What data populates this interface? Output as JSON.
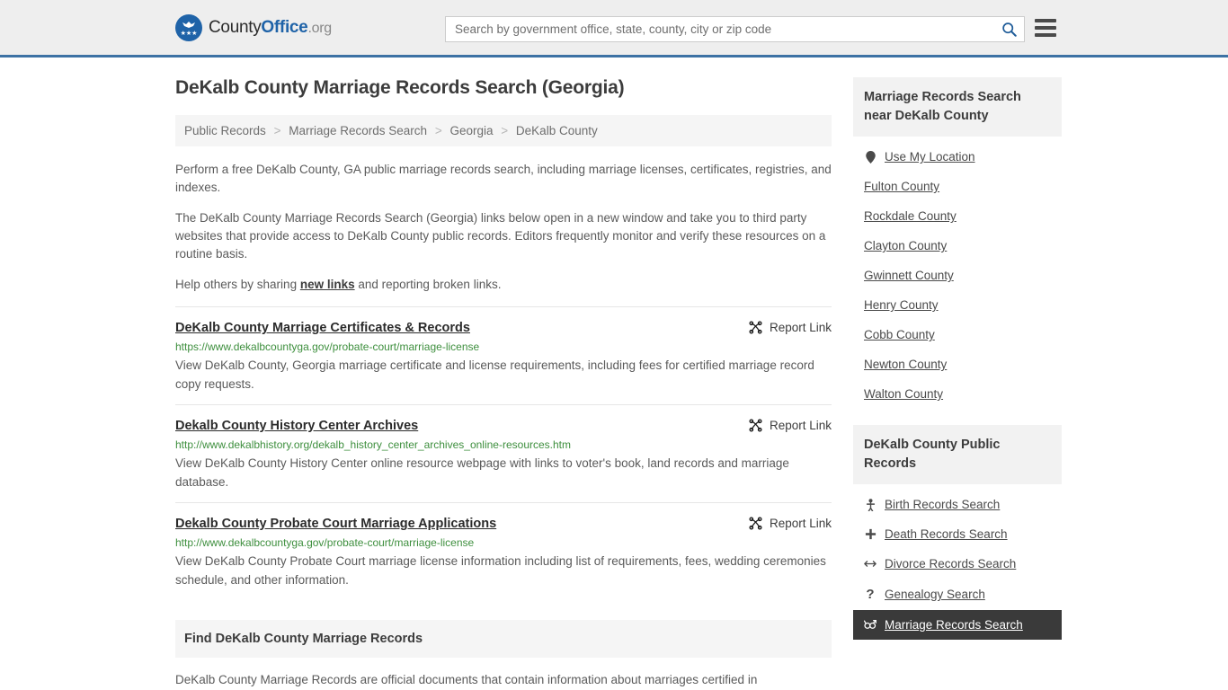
{
  "header": {
    "logo": {
      "part1": "County",
      "part2": "Office",
      "part3": ".org",
      "icon": "eagle-seal-logo",
      "stars": "★★★"
    },
    "search": {
      "placeholder": "Search by government office, state, county, city or zip code",
      "value": "",
      "icon": "search-icon"
    },
    "menu_icon": "hamburger-menu-icon",
    "accent_color": "#3d72a4"
  },
  "main": {
    "title": "DeKalb County Marriage Records Search (Georgia)",
    "breadcrumb": [
      {
        "label": "Public Records"
      },
      {
        "label": "Marriage Records Search"
      },
      {
        "label": "Georgia"
      },
      {
        "label": "DeKalb County"
      }
    ],
    "breadcrumb_separator": ">",
    "intro": {
      "p1": "Perform a free DeKalb County, GA public marriage records search, including marriage licenses, certificates, registries, and indexes.",
      "p2": "The DeKalb County Marriage Records Search (Georgia) links below open in a new window and take you to third party websites that provide access to DeKalb County public records. Editors frequently monitor and verify these resources on a routine basis.",
      "p3_before": "Help others by sharing ",
      "p3_link": "new links",
      "p3_after": " and reporting broken links."
    },
    "report_link_label": "Report Link",
    "report_link_icon": "broken-link-icon",
    "results": [
      {
        "title": "DeKalb County Marriage Certificates & Records",
        "url": "https://www.dekalbcountyga.gov/probate-court/marriage-license",
        "description": "View DeKalb County, Georgia marriage certificate and license requirements, including fees for certified marriage record copy requests."
      },
      {
        "title": "Dekalb County History Center Archives",
        "url": "http://www.dekalbhistory.org/dekalb_history_center_archives_online-resources.htm",
        "description": "View DeKalb County History Center online resource webpage with links to voter's book, land records and marriage database."
      },
      {
        "title": "Dekalb County Probate Court Marriage Applications",
        "url": "http://www.dekalbcountyga.gov/probate-court/marriage-license",
        "description": "View DeKalb County Probate Court marriage license information including list of requirements, fees, wedding ceremonies schedule, and other information."
      }
    ],
    "find_section": {
      "heading": "Find DeKalb County Marriage Records",
      "body": "DeKalb County Marriage Records are official documents that contain information about marriages certified in"
    }
  },
  "sidebar": {
    "nearby": {
      "heading": "Marriage Records Search near DeKalb County",
      "items": [
        {
          "label": "Use My Location",
          "icon": "map-pin-icon",
          "has_icon": true
        },
        {
          "label": "Fulton County",
          "has_icon": false
        },
        {
          "label": "Rockdale County",
          "has_icon": false
        },
        {
          "label": "Clayton County",
          "has_icon": false
        },
        {
          "label": "Gwinnett County",
          "has_icon": false
        },
        {
          "label": "Henry County",
          "has_icon": false
        },
        {
          "label": "Cobb County",
          "has_icon": false
        },
        {
          "label": "Newton County",
          "has_icon": false
        },
        {
          "label": "Walton County",
          "has_icon": false
        }
      ]
    },
    "public_records": {
      "heading": "DeKalb County Public Records",
      "active_color": "#3a3a3a",
      "items": [
        {
          "label": "Birth Records Search",
          "icon": "baby-icon",
          "glyph": "Ѧ",
          "active": false
        },
        {
          "label": "Death Records Search",
          "icon": "cross-icon",
          "glyph": "✚",
          "active": false
        },
        {
          "label": "Divorce Records Search",
          "icon": "split-arrows-icon",
          "glyph": "↔",
          "active": false
        },
        {
          "label": "Genealogy Search",
          "icon": "question-mark-icon",
          "glyph": "?",
          "active": false
        },
        {
          "label": "Marriage Records Search",
          "icon": "male-female-icon",
          "glyph": "⚥",
          "active": true
        }
      ]
    }
  }
}
